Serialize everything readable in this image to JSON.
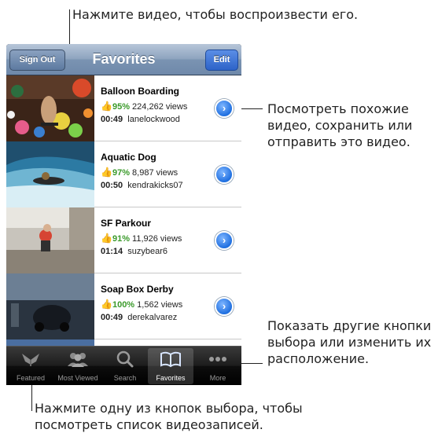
{
  "callouts": {
    "top": "Нажмите видео, чтобы воспроизвести его.",
    "right_detail": "Посмотреть похожие видео, сохранить или отправить это видео.",
    "right_more": "Показать другие кнопки выбора или изменить их расположение.",
    "bottom": "Нажмите одну из кнопок выбора, чтобы посмотреть список видеозаписей."
  },
  "navbar": {
    "title": "Favorites",
    "left_button": "Sign Out",
    "right_button": "Edit"
  },
  "videos": [
    {
      "title": "Balloon Boarding",
      "rating": "95%",
      "views": "224,262 views",
      "duration": "00:49",
      "user": "lanelockwood"
    },
    {
      "title": "Aquatic Dog",
      "rating": "97%",
      "views": "8,987 views",
      "duration": "00:50",
      "user": "kendrakicks07"
    },
    {
      "title": "SF Parkour",
      "rating": "91%",
      "views": "11,926 views",
      "duration": "01:14",
      "user": "suzybear6"
    },
    {
      "title": "Soap Box Derby",
      "rating": "100%",
      "views": "1,562 views",
      "duration": "00:49",
      "user": "derekalvarez"
    }
  ],
  "tabs": [
    {
      "label": "Featured",
      "icon": "featured-icon"
    },
    {
      "label": "Most Viewed",
      "icon": "most-viewed-icon"
    },
    {
      "label": "Search",
      "icon": "search-icon"
    },
    {
      "label": "Favorites",
      "icon": "favorites-book-icon",
      "active": true
    },
    {
      "label": "More",
      "icon": "more-dots-icon"
    }
  ],
  "icons": {
    "thumbs_up": "thumbs-up-icon",
    "disclosure": "detail-disclosure-icon"
  },
  "colors": {
    "navbar": "#7a93b2",
    "edit_button": "#2d63c8",
    "rating_green": "#3a9a2a",
    "disclosure_blue": "#1f6fe0",
    "tabbar": "#1c1c1c"
  }
}
